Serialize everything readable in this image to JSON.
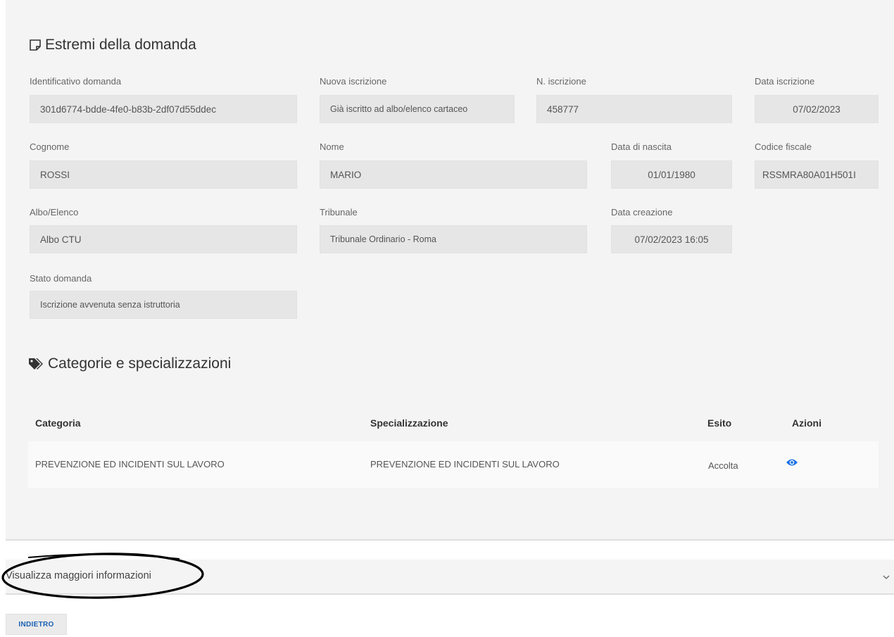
{
  "section1": {
    "title": "Estremi della domanda",
    "icon": "note-icon"
  },
  "fields": {
    "identificativo": {
      "label": "Identificativo domanda",
      "value": "301d6774-bdde-4fe0-b83b-2df07d55ddec"
    },
    "nuova_iscrizione": {
      "label": "Nuova iscrizione",
      "value": "Già iscritto ad albo/elenco cartaceo"
    },
    "n_iscrizione": {
      "label": "N. iscrizione",
      "value": "458777"
    },
    "data_iscrizione": {
      "label": "Data iscrizione",
      "value": "07/02/2023"
    },
    "cognome": {
      "label": "Cognome",
      "value": "ROSSI"
    },
    "nome": {
      "label": "Nome",
      "value": "MARIO"
    },
    "data_nascita": {
      "label": "Data di nascita",
      "value": "01/01/1980"
    },
    "codice_fiscale": {
      "label": "Codice fiscale",
      "value": "RSSMRA80A01H501I"
    },
    "albo": {
      "label": "Albo/Elenco",
      "value": "Albo CTU"
    },
    "tribunale": {
      "label": "Tribunale",
      "value": "Tribunale Ordinario - Roma"
    },
    "data_creazione": {
      "label": "Data creazione",
      "value": "07/02/2023 16:05"
    },
    "stato": {
      "label": "Stato domanda",
      "value": "Iscrizione avvenuta senza istruttoria"
    }
  },
  "section2": {
    "title": "Categorie e specializzazioni",
    "icon": "tags-icon"
  },
  "table": {
    "headers": {
      "categoria": "Categoria",
      "specializzazione": "Specializzazione",
      "esito": "Esito",
      "azioni": "Azioni"
    },
    "rows": [
      {
        "categoria": "PREVENZIONE ED INCIDENTI SUL LAVORO",
        "specializzazione": "PREVENZIONE ED INCIDENTI SUL LAVORO",
        "esito": "Accolta",
        "action_icon": "eye-icon"
      }
    ]
  },
  "accordion": {
    "label": "Visualizza maggiori informazioni",
    "icon": "chevron-down-icon"
  },
  "back_button": {
    "label": "INDIETRO"
  },
  "colors": {
    "accent": "#1a73e8",
    "panel": "#f4f4f4",
    "field": "#e6e6e6"
  }
}
